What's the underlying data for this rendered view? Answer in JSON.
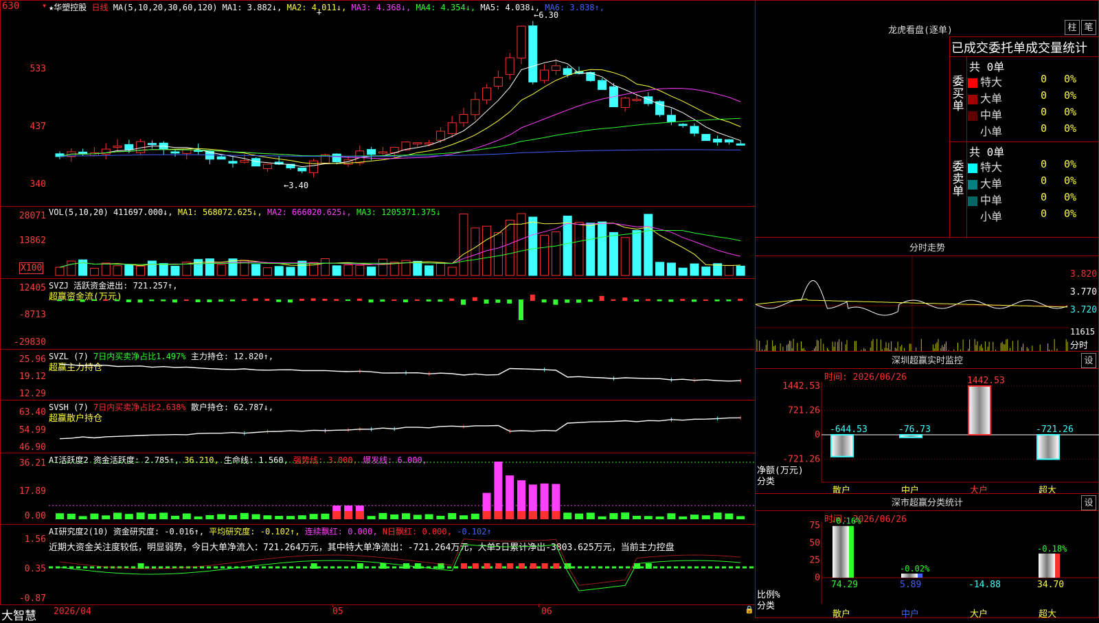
{
  "app": {
    "brand": "大智慧",
    "stock": "★华塑控股",
    "period": "日线"
  },
  "kline": {
    "ma_label": "MA(5,10,20,30,60,120)",
    "ma": [
      {
        "label": "MA1:",
        "value": "3.882↓",
        "color": "#ffffff"
      },
      {
        "label": "MA2:",
        "value": "4.011↓",
        "color": "#ffff40"
      },
      {
        "label": "MA3:",
        "value": "4.368↓",
        "color": "#ff40ff"
      },
      {
        "label": "MA4:",
        "value": "4.354↓",
        "color": "#30ff30"
      },
      {
        "label": "MA5:",
        "value": "4.038↓",
        "color": "#ffffff"
      },
      {
        "label": "MA6:",
        "value": "3.838↑",
        "color": "#4060ff"
      }
    ],
    "yticks": [
      "630",
      "533",
      "437",
      "340"
    ],
    "high_mark": "←6.30",
    "low_mark": "←3.40"
  },
  "vol": {
    "label": "VOL(5,10,20)",
    "value": "411697.000↓,",
    "ma1": "MA1: 568072.625↓,",
    "ma2": "MA2: 666020.625↓,",
    "ma3": "MA3: 1205371.375↓",
    "yticks": [
      "28071",
      "13862"
    ],
    "unit": "X100"
  },
  "svzj": {
    "label": "SVZJ",
    "text": "活跃资金进出: 721.257↑,",
    "sub": "超赢资金流(万元)",
    "yticks": [
      "12405",
      "-8713",
      "-29830"
    ]
  },
  "svzl": {
    "label": "SVZL (7)",
    "text1": "7日内买卖净占比1.497%",
    "text2": "主力持仓: 12.820↑,",
    "sub": "超赢主力持仓",
    "yticks": [
      "25.96",
      "19.12",
      "12.29"
    ]
  },
  "svsh": {
    "label": "SVSH (7)",
    "text1": "7日内买卖净占比2.638%",
    "text2": "散户持仓: 62.787↓,",
    "sub": "超赢散户持仓",
    "yticks": [
      "63.40",
      "54.99",
      "46.90"
    ]
  },
  "ai1": {
    "label": "AI活跃度2",
    "t1": "资金活跃度: 2.785↑,",
    "t2": "36.210,",
    "t3": "生命线: 1.560,",
    "t4": "强势线: 3.000,",
    "t5": "爆发线: 6.000,",
    "yticks": [
      "36.21",
      "17.89",
      "0.00"
    ]
  },
  "ai2": {
    "label": "AI研究度2(10)",
    "t1": "资金研究度: -0.016↑,",
    "t2": "平均研究度: -0.102↑,",
    "t3": "连续飘红: 0.000,",
    "t4": "N日飘红: 0.000,",
    "t5": "-0.102↑",
    "comment": "近期大资金关注度较低，明显弱势，今日大单净流入：721.264万元，其中特大单净流出：-721.264万元，大单5日累计净出-3803.625万元，当前主力控盘",
    "yticks": [
      "1.56",
      "0.35",
      "-0.87"
    ]
  },
  "xaxis": [
    "2026/04",
    "05",
    "06"
  ],
  "lhb": {
    "title": "龙虎看盘(逐单)",
    "btn1": "柱",
    "btn2": "笔",
    "header": "已成交委托单成交量统计",
    "buy_label": "委买单",
    "sell_label": "委卖单",
    "buy_total": "共 0单",
    "sell_total": "共 0单",
    "buy_rows": [
      {
        "name": "特大",
        "count": "0",
        "pct": "0%",
        "color": "#ff0000"
      },
      {
        "name": "大单",
        "count": "0",
        "pct": "0%",
        "color": "#a00000"
      },
      {
        "name": "中单",
        "count": "0",
        "pct": "0%",
        "color": "#600000"
      },
      {
        "name": "小单",
        "count": "0",
        "pct": "0%",
        "color": ""
      }
    ],
    "sell_rows": [
      {
        "name": "特大",
        "count": "0",
        "pct": "0%",
        "color": "#00ffff"
      },
      {
        "name": "大单",
        "count": "0",
        "pct": "0%",
        "color": "#008080"
      },
      {
        "name": "中单",
        "count": "0",
        "pct": "0%",
        "color": "#006666"
      },
      {
        "name": "小单",
        "count": "0",
        "pct": "0%",
        "color": ""
      }
    ]
  },
  "fenshi": {
    "title": "分时走势",
    "prices": [
      "3.820",
      "3.770",
      "3.720"
    ],
    "vol": "11615",
    "unit": "分时"
  },
  "monitor": {
    "title": "深圳超赢实时监控",
    "btn": "设",
    "date": "时间: 2026/06/26",
    "yticks": [
      "1442.53",
      "721.26",
      "0",
      "-721.26"
    ],
    "ylabel": "净额(万元)",
    "xlabel": "分类",
    "bars": [
      {
        "name": "散户",
        "label": "-644.53",
        "value": -644.53
      },
      {
        "name": "中户",
        "label": "-76.73",
        "value": -76.73
      },
      {
        "name": "大户",
        "label": "1442.53",
        "value": 1442.53
      },
      {
        "name": "超大",
        "label": "-721.26",
        "value": -721.26
      }
    ]
  },
  "classify": {
    "title": "深市超赢分类统计",
    "btn": "设",
    "date": "时间: 2026/06/26",
    "yticks": [
      "75",
      "50",
      "25",
      "0"
    ],
    "ylabel": "比例%",
    "xlabel": "分类",
    "bars": [
      {
        "name": "散户",
        "top": "-0.16%",
        "bottom": "74.29",
        "value": 74.29
      },
      {
        "name": "中户",
        "top": "-0.02%",
        "bottom": "5.89",
        "value": 5.89
      },
      {
        "name": "大户",
        "top": "",
        "bottom": "-14.88",
        "value": 0
      },
      {
        "name": "超大",
        "top": "-0.18%",
        "bottom": "34.70",
        "value": 34.7
      }
    ]
  }
}
